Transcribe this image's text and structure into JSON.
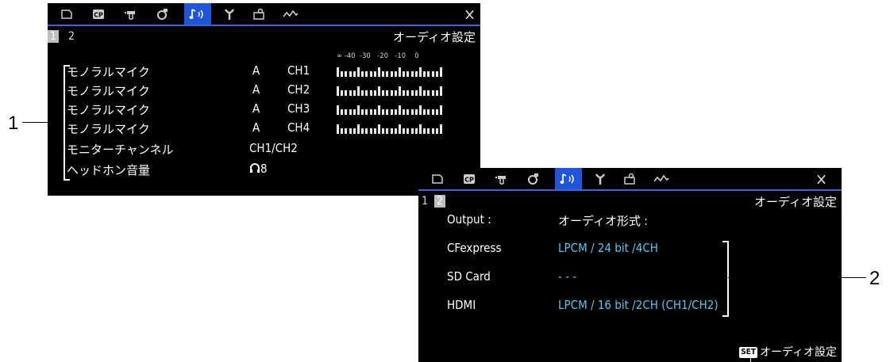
{
  "screen1": {
    "pages": [
      "1",
      "2"
    ],
    "active_page": "1",
    "title": "オーディオ設定",
    "meter_scale": "∞ -40  -30   -20   -10    0",
    "rows": [
      {
        "label": "モノラルマイク",
        "input": "A",
        "channel": "CH1"
      },
      {
        "label": "モノラルマイク",
        "input": "A",
        "channel": "CH2"
      },
      {
        "label": "モノラルマイク",
        "input": "A",
        "channel": "CH3"
      },
      {
        "label": "モノラルマイク",
        "input": "A",
        "channel": "CH4"
      }
    ],
    "monitor": {
      "label": "モニターチャンネル",
      "value": "CH1/CH2"
    },
    "headphone": {
      "label": "ヘッドホン音量",
      "icon": "headphone-icon",
      "value": "8"
    }
  },
  "screen2": {
    "pages": [
      "1",
      "2"
    ],
    "active_page": "2",
    "title": "オーディオ設定",
    "output_label": "Output :",
    "format_label": "オーディオ形式 :",
    "rows": [
      {
        "label": "CFexpress",
        "value": "LPCM / 24 bit /4CH"
      },
      {
        "label": "SD Card",
        "value": "- - -"
      },
      {
        "label": "HDMI",
        "value": "LPCM / 16 bit /2CH (CH1/CH2)"
      }
    ],
    "set_key": "SET",
    "set_label": "オーディオ設定"
  },
  "tabs": [
    "card-icon",
    "cp-icon",
    "camera-icon",
    "custom-picture-icon",
    "audio-icon",
    "tools-icon",
    "user-icon",
    "waveform-icon"
  ],
  "close_symbol": "×",
  "callouts": [
    "1",
    "2"
  ],
  "colors": {
    "accent": "#1f55d6",
    "value_text": "#58c6ee"
  }
}
